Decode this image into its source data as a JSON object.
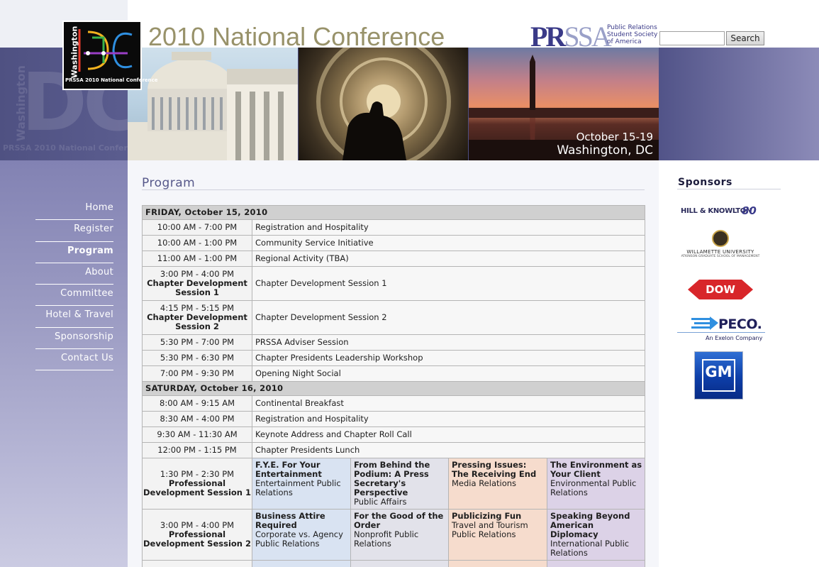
{
  "header": {
    "logo_wordmark": "DC",
    "logo_side_text": "Washington",
    "logo_subtitle": "PRSSA 2010 National Conference",
    "conference_title": "2010 National Conference",
    "org_mark": "PRSSA",
    "org_tagline": "Public Relations Student Society of America",
    "search_value": "",
    "search_button": "Search",
    "banner_dates": "October 15-19",
    "banner_city": "Washington, DC"
  },
  "nav": {
    "items": [
      {
        "label": "Home",
        "active": false
      },
      {
        "label": "Register",
        "active": false
      },
      {
        "label": "Program",
        "active": true
      },
      {
        "label": "About",
        "active": false
      },
      {
        "label": "Committee",
        "active": false
      },
      {
        "label": "Hotel & Travel",
        "active": false
      },
      {
        "label": "Sponsorship",
        "active": false
      },
      {
        "label": "Contact Us",
        "active": false
      }
    ]
  },
  "main": {
    "heading": "Program",
    "days": [
      {
        "label": "FRIDAY, October 15, 2010",
        "events": [
          {
            "time": "10:00 AM - 7:00 PM",
            "title": "Registration and Hospitality"
          },
          {
            "time": "10:00 AM - 1:00 PM",
            "title": "Community Service Initiative"
          },
          {
            "time": "11:00 AM - 1:00 PM",
            "title": "Regional Activity (TBA)"
          },
          {
            "time": "3:00 PM - 4:00 PM",
            "subtitle": "Chapter Development Session 1",
            "title": "Chapter Development Session 1"
          },
          {
            "time": "4:15 PM - 5:15 PM",
            "subtitle": "Chapter Development Session 2",
            "title": "Chapter Development Session 2"
          },
          {
            "time": "5:30 PM - 7:00 PM",
            "title": "PRSSA Adviser Session"
          },
          {
            "time": "5:30 PM - 6:30 PM",
            "title": "Chapter Presidents Leadership Workshop"
          },
          {
            "time": "7:00 PM - 9:30 PM",
            "title": "Opening Night Social"
          }
        ]
      },
      {
        "label": "SATURDAY, October 16, 2010",
        "events": [
          {
            "time": "8:00 AM - 9:15 AM",
            "title": "Continental Breakfast"
          },
          {
            "time": "8:30 AM - 4:00 PM",
            "title": "Registration and Hospitality"
          },
          {
            "time": "9:30 AM - 11:30 AM",
            "title": "Keynote Address and Chapter Roll Call"
          },
          {
            "time": "12:00 PM - 1:15 PM",
            "title": "Chapter Presidents Lunch"
          }
        ],
        "pd_sessions": [
          {
            "time": "1:30 PM - 2:30 PM",
            "label": "Professional Development Session 1",
            "tracks": [
              {
                "title": "F.Y.E. For Your Entertainment",
                "topic": "Entertainment Public Relations"
              },
              {
                "title": "From Behind the Podium: A Press Secretary's Perspective",
                "topic": "Public Affairs"
              },
              {
                "title": "Pressing Issues: The Receiving End",
                "topic": "Media Relations"
              },
              {
                "title": "The Environment as Your Client",
                "topic": "Environmental Public Relations"
              }
            ]
          },
          {
            "time": "3:00 PM - 4:00 PM",
            "label": "Professional Development Session 2",
            "tracks": [
              {
                "title": "Business Attire Required",
                "topic": "Corporate vs. Agency Public Relations"
              },
              {
                "title": "For the Good of the Order",
                "topic": "Nonprofit Public Relations"
              },
              {
                "title": "Publicizing Fun",
                "topic": "Travel and Tourism Public Relations"
              },
              {
                "title": "Speaking Beyond American Diplomacy",
                "topic": "International Public Relations"
              }
            ]
          }
        ]
      }
    ]
  },
  "sponsors": {
    "heading": "Sponsors",
    "items": [
      {
        "name": "HILL & KNOWLTON",
        "extra": "80"
      },
      {
        "name": "WILLAMETTE UNIVERSITY",
        "extra": "ATKINSON GRADUATE SCHOOL OF MANAGEMENT"
      },
      {
        "name": "DOW"
      },
      {
        "name": "PECO.",
        "extra": "An Exelon Company"
      },
      {
        "name": "GM"
      }
    ]
  },
  "colors": {
    "band": "#4f5182",
    "title": "#98926a",
    "nav_bg": "#8282b3",
    "pd_blue": "#d9e3f2",
    "pd_gray": "#e2e2ea",
    "pd_peach": "#f6dccd",
    "pd_purple": "#dcd2e7"
  }
}
